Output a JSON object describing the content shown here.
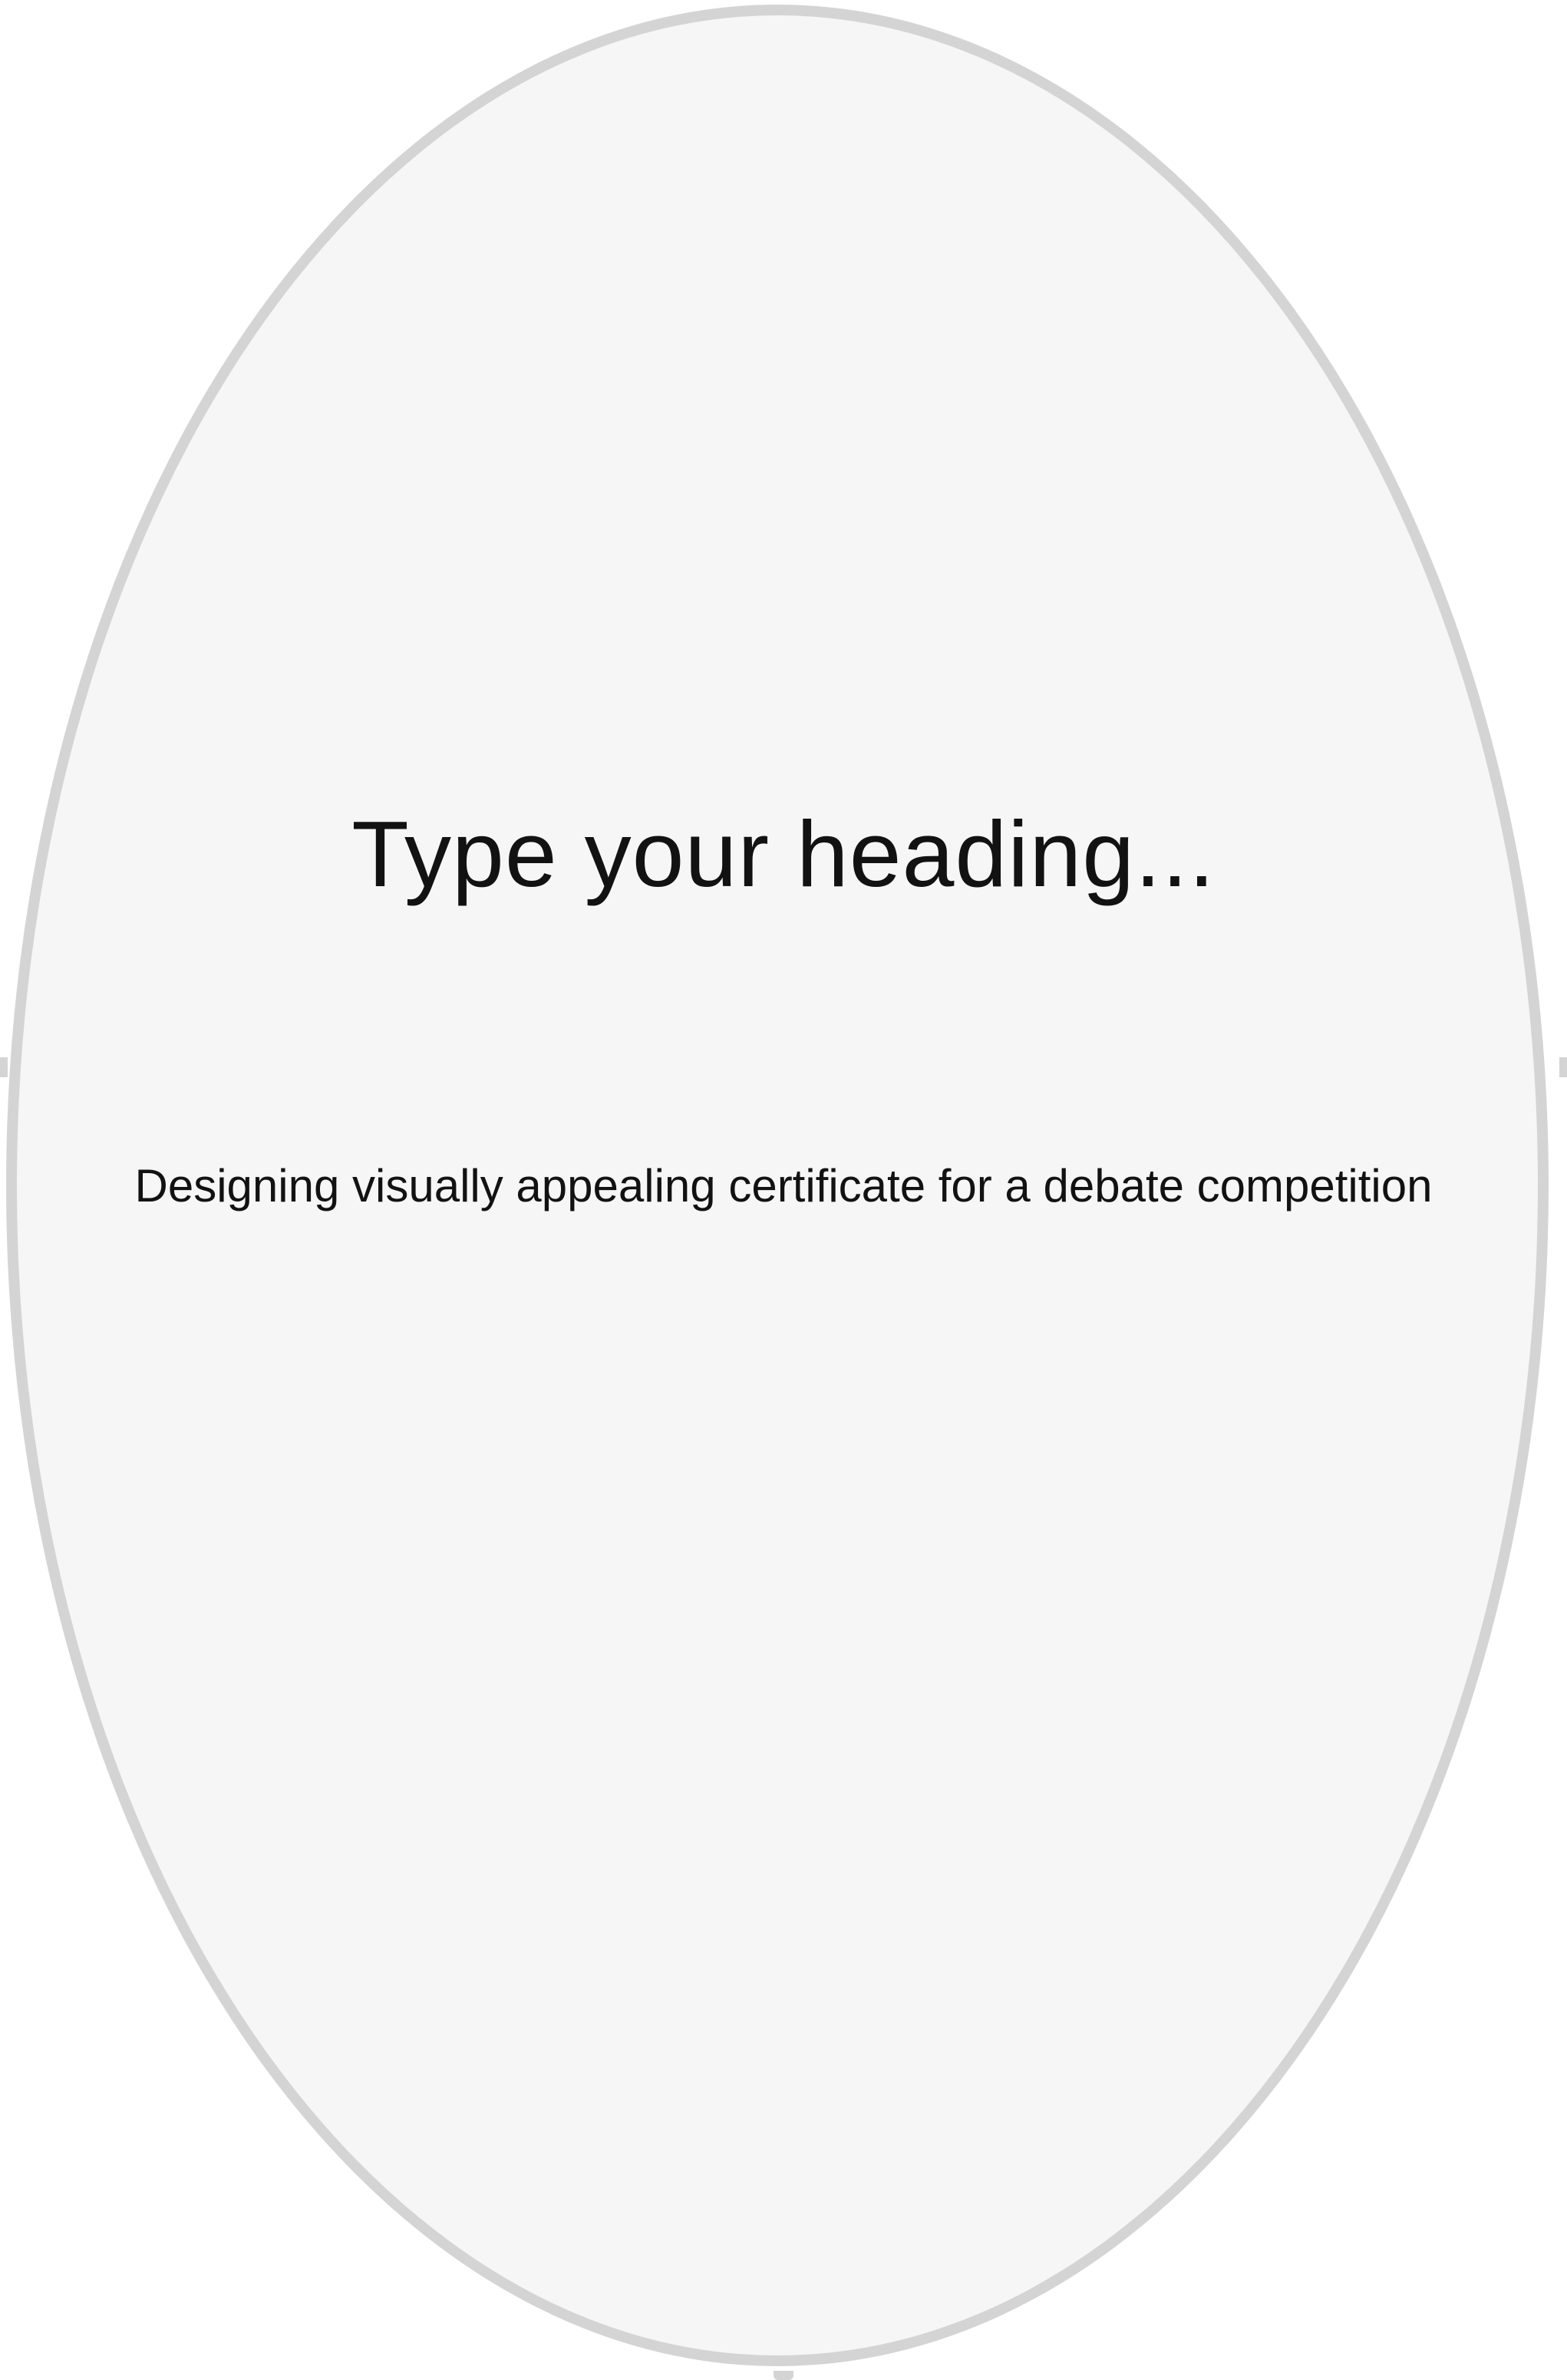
{
  "card": {
    "heading": "Type your heading...",
    "description": "Designing visually appealing certificate for a debate competition"
  },
  "colors": {
    "frame_border": "#d4d4d4",
    "frame_fill": "#f6f6f6",
    "text": "#121212",
    "background": "#ffffff"
  }
}
